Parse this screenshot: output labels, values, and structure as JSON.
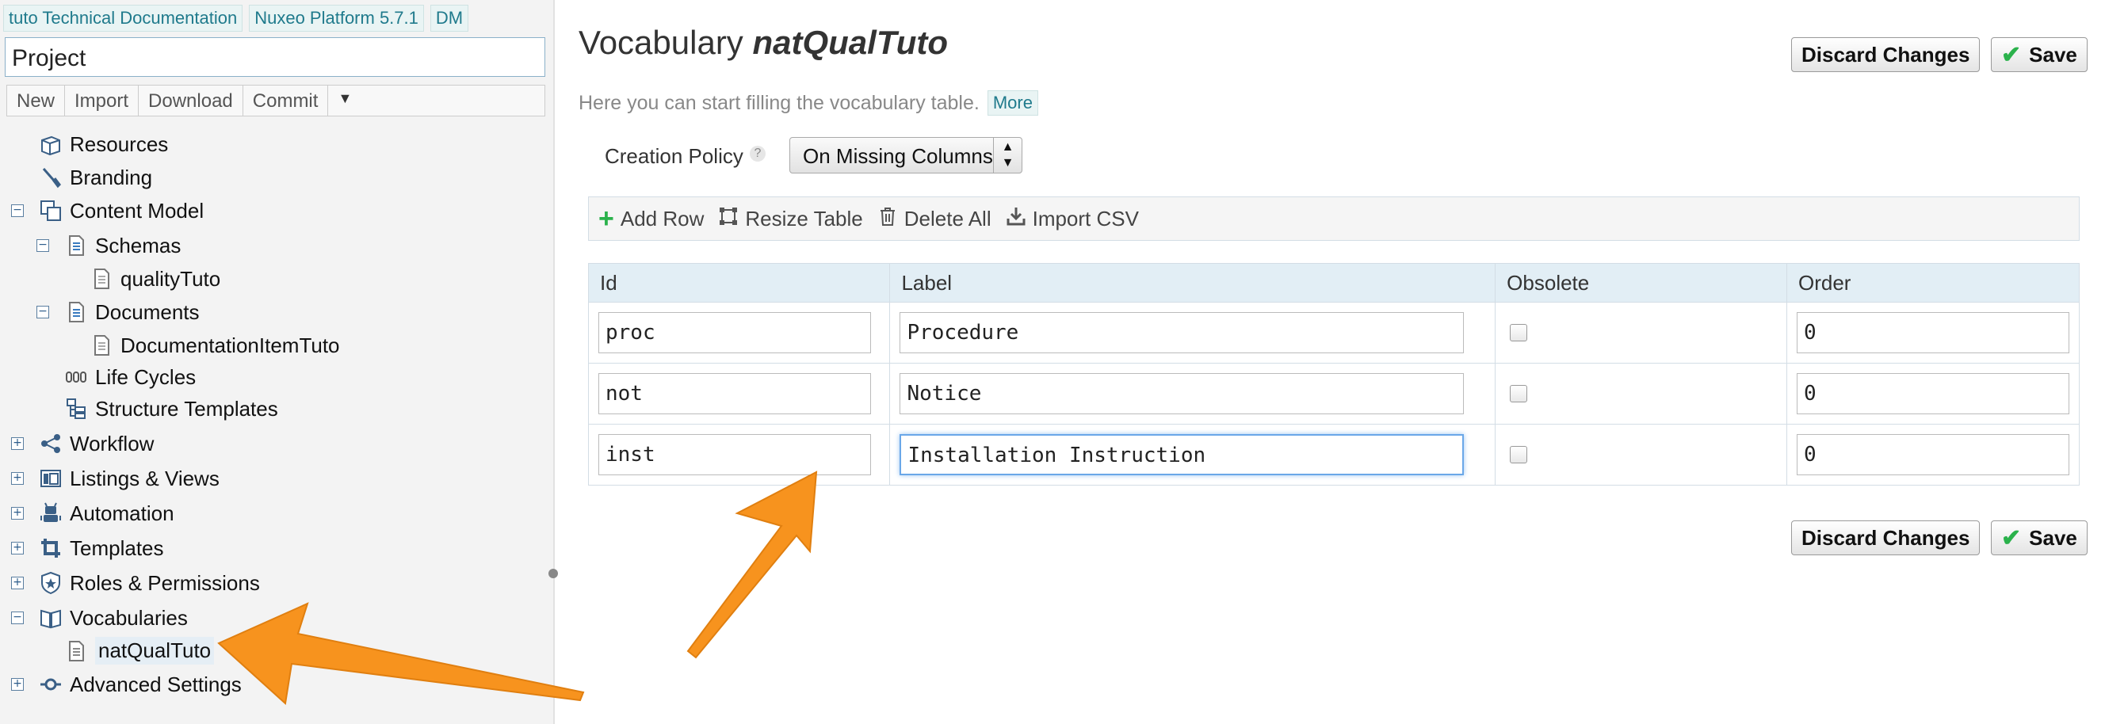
{
  "breadcrumbs": [
    "tuto Technical Documentation",
    "Nuxeo Platform 5.7.1",
    "DM"
  ],
  "project": {
    "name": "Project",
    "tools": [
      "New",
      "Import",
      "Download",
      "Commit"
    ]
  },
  "tree": [
    {
      "label": "Resources",
      "icon": "resources-icon"
    },
    {
      "label": "Branding",
      "icon": "branding-icon"
    },
    {
      "label": "Content Model",
      "icon": "content-model-icon",
      "toggle": "⊟"
    },
    {
      "label": "Schemas",
      "icon": "schema-icon",
      "toggle": "⊟"
    },
    {
      "label": "qualityTuto",
      "icon": "document-file-icon"
    },
    {
      "label": "Documents",
      "icon": "documents-icon",
      "toggle": "⊟"
    },
    {
      "label": "DocumentationItemTuto",
      "icon": "document-file-icon"
    },
    {
      "label": "Life Cycles",
      "icon": "lifecycle-icon"
    },
    {
      "label": "Structure Templates",
      "icon": "structure-templates-icon"
    },
    {
      "label": "Workflow",
      "icon": "workflow-icon",
      "toggle": "⊞"
    },
    {
      "label": "Listings & Views",
      "icon": "listings-icon",
      "toggle": "⊞"
    },
    {
      "label": "Automation",
      "icon": "automation-icon",
      "toggle": "⊞"
    },
    {
      "label": "Templates",
      "icon": "templates-icon",
      "toggle": "⊞"
    },
    {
      "label": "Roles & Permissions",
      "icon": "roles-icon",
      "toggle": "⊞"
    },
    {
      "label": "Vocabularies",
      "icon": "vocabularies-icon",
      "toggle": "⊟"
    },
    {
      "label": "natQualTuto",
      "icon": "vocabulary-file-icon"
    },
    {
      "label": "Advanced Settings",
      "icon": "advanced-settings-icon",
      "toggle": "⊞"
    }
  ],
  "page": {
    "title_prefix": "Vocabulary",
    "vocab_name": "natQualTuto",
    "subtitle": "Here you can start filling the vocabulary table.",
    "more_label": "More",
    "discard_label": "Discard Changes",
    "save_label": "Save"
  },
  "policy": {
    "label": "Creation Policy",
    "help": "?",
    "value": "On Missing Columns"
  },
  "toolbar": {
    "add_row": "Add Row",
    "resize_table": "Resize Table",
    "delete_all": "Delete All",
    "import_csv": "Import CSV"
  },
  "table": {
    "headers": [
      "Id",
      "Label",
      "Obsolete",
      "Order"
    ],
    "rows": [
      {
        "id": "proc",
        "label": "Procedure",
        "obsolete": false,
        "order": "0"
      },
      {
        "id": "not",
        "label": "Notice",
        "obsolete": false,
        "order": "0"
      },
      {
        "id": "inst",
        "label": "Installation Instruction",
        "obsolete": false,
        "order": "0"
      }
    ]
  },
  "colors": {
    "accent": "#1f7a8c",
    "save_check": "#2bb24c",
    "arrow": "#f7931e"
  }
}
